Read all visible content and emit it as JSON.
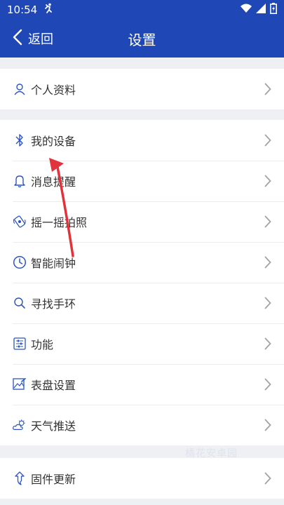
{
  "status_bar": {
    "time": "10:54"
  },
  "header": {
    "back_label": "返回",
    "title": "设置"
  },
  "group1": [
    {
      "label": "个人资料",
      "icon": "person-icon"
    }
  ],
  "group2": [
    {
      "label": "我的设备",
      "icon": "bluetooth-icon"
    },
    {
      "label": "消息提醒",
      "icon": "bell-icon"
    },
    {
      "label": "摇一摇拍照",
      "icon": "shake-camera-icon"
    },
    {
      "label": "智能闹钟",
      "icon": "clock-icon"
    },
    {
      "label": "寻找手环",
      "icon": "search-icon"
    },
    {
      "label": "功能",
      "icon": "sliders-icon"
    },
    {
      "label": "表盘设置",
      "icon": "watchface-icon"
    },
    {
      "label": "天气推送",
      "icon": "weather-icon"
    }
  ],
  "group3": [
    {
      "label": "固件更新",
      "icon": "firmware-update-icon"
    }
  ],
  "watermark": "橘花安卓园",
  "colors": {
    "header": "#1f47b5",
    "icon": "#2b55c4",
    "annotation_arrow": "#e2333d"
  }
}
